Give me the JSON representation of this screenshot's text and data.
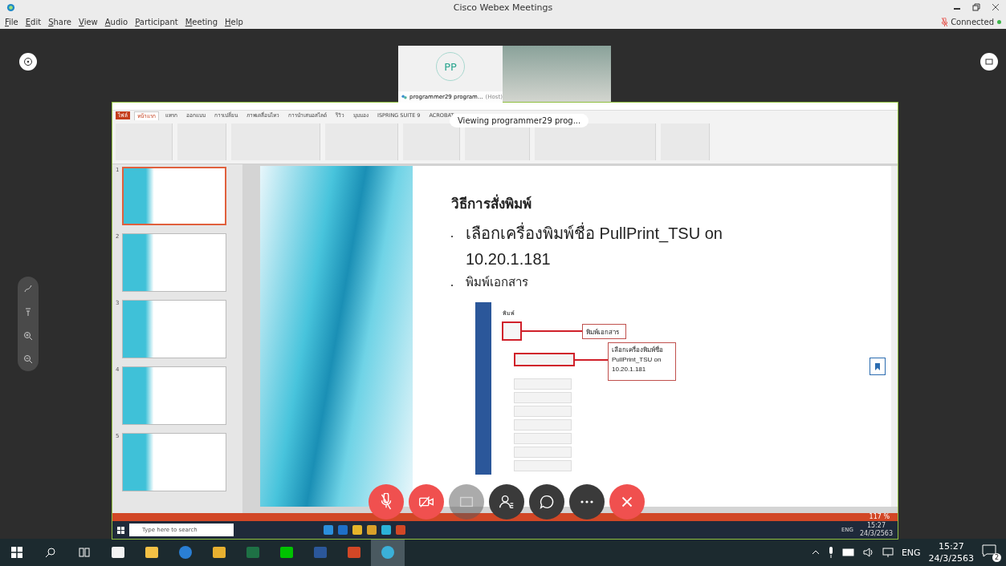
{
  "window": {
    "title": "Cisco Webex Meetings",
    "status": "Connected"
  },
  "menu": [
    "File",
    "Edit",
    "Share",
    "View",
    "Audio",
    "Participant",
    "Meeting",
    "Help"
  ],
  "participants": [
    {
      "kind": "avatar",
      "initials": "PP",
      "name": "programmer29 program...",
      "role": "(Host)"
    },
    {
      "kind": "video"
    }
  ],
  "viewing_banner": "Viewing programmer29 prog...",
  "shared_screen": {
    "ribbon_tabs": [
      {
        "label": "ไฟล์",
        "selected": false,
        "kind": "file"
      },
      {
        "label": "หน้าแรก",
        "selected": true,
        "kind": "tab"
      },
      {
        "label": "แทรก",
        "selected": false,
        "kind": "tab"
      },
      {
        "label": "ออกแบบ",
        "selected": false,
        "kind": "tab"
      },
      {
        "label": "การเปลี่ยน",
        "selected": false,
        "kind": "tab"
      },
      {
        "label": "ภาพเคลื่อนไหว",
        "selected": false,
        "kind": "tab"
      },
      {
        "label": "การนำเสนอสไลด์",
        "selected": false,
        "kind": "tab"
      },
      {
        "label": "รีวิว",
        "selected": false,
        "kind": "tab"
      },
      {
        "label": "มุมมอง",
        "selected": false,
        "kind": "tab"
      },
      {
        "label": "ISPRING SUITE 9",
        "selected": false,
        "kind": "tab"
      },
      {
        "label": "ACROBAT",
        "selected": false,
        "kind": "tab"
      }
    ],
    "thumbnails": [
      {
        "number": "1",
        "selected": true
      },
      {
        "number": "2",
        "selected": false
      },
      {
        "number": "3",
        "selected": false
      },
      {
        "number": "4",
        "selected": false
      },
      {
        "number": "5",
        "selected": false
      }
    ],
    "slide": {
      "title": "วิธีการสั่งพิมพ์",
      "bullets": [
        {
          "text": "เลือกเครื่องพิมพ์ชื่อ PullPrint_TSU on",
          "continuation": "10.20.1.181",
          "kind": "large"
        },
        {
          "text": "พิมพ์เอกสาร",
          "kind": "small"
        }
      ],
      "dialog_title": "พิมพ์",
      "callouts": [
        "พิมพ์เอกสาร",
        "เลือกเครื่องพิมพ์ชื่อ PullPrint_TSU on 10.20.1.181"
      ]
    },
    "zoom": "117 %",
    "taskbar": {
      "search_placeholder": "Type here to search",
      "language": "ENG",
      "time": "15:27",
      "date": "24/3/2563"
    }
  },
  "controls": [
    {
      "kind": "mic",
      "disabled": false
    },
    {
      "kind": "video",
      "disabled": false
    },
    {
      "kind": "share",
      "disabled": true
    },
    {
      "kind": "participants",
      "disabled": false
    },
    {
      "kind": "chat",
      "disabled": false
    },
    {
      "kind": "more",
      "disabled": false
    },
    {
      "kind": "leave",
      "disabled": false
    }
  ],
  "taskbar": {
    "language": "ENG",
    "time": "15:27",
    "date": "24/3/2563",
    "notifications": "2"
  }
}
